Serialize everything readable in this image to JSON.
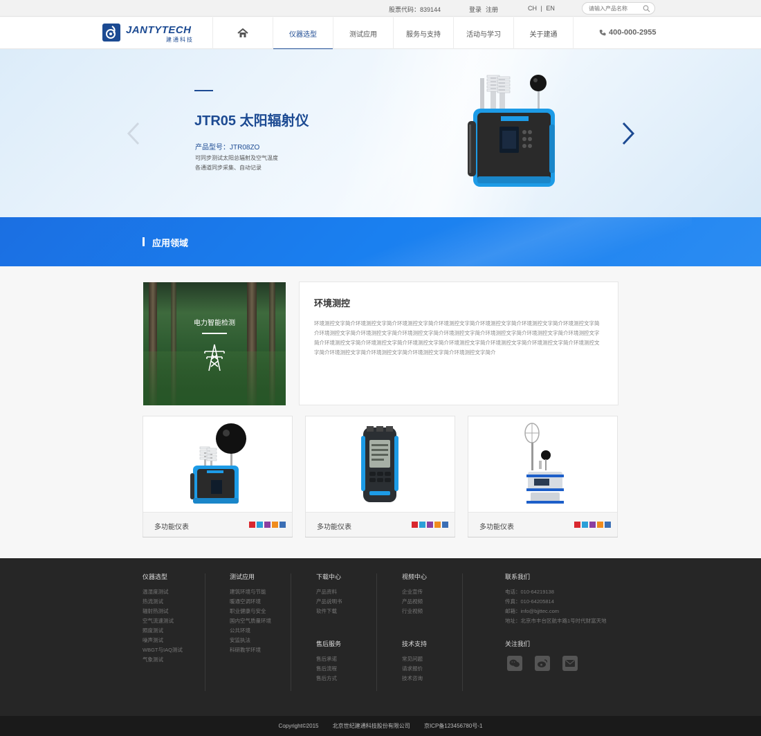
{
  "topbar": {
    "stock": "股票代码：839144",
    "login": "登录",
    "register": "注册",
    "lang_ch": "CH",
    "lang_sep": "|",
    "lang_en": "EN",
    "search_placeholder": "请输入产品名称"
  },
  "logo": {
    "name": "JANTYTECH",
    "sub": "建通科技"
  },
  "nav": {
    "items": [
      {
        "label": "仪器选型",
        "active": true
      },
      {
        "label": "测试应用"
      },
      {
        "label": "服务与支持"
      },
      {
        "label": "活动与学习"
      },
      {
        "label": "关于建通"
      }
    ],
    "phone": "400-000-2955"
  },
  "banner": {
    "title": "JTR05 太阳辐射仪",
    "model": "产品型号：JTR08ZO",
    "desc_line1": "可同步测试太阳总辐射及空气温度",
    "desc_line2": "各通道同步采集、自动记录"
  },
  "apps": {
    "heading": "应用领域",
    "feature_label": "电力智能检测",
    "feature_title": "环境测控",
    "feature_text": "环境测控文字简介环境测控文字简介环境测控文字简介环境测控文字简介环境测控文字简介环境测控文字简介环境测控文字简介环境测控文字简介环境测控文字简介环境测控文字简介环境测控文字简介环境测控文字简介环境测控文字简介环境测控文字简介环境测控文字简介环境测控文字简介环境测控文字简介环境测控文字简介环境测控文字简介环境测控文字简介环境测控文字简介环境测控文字简介环境测控文字简介环境测控文字简介环境测控文字简介"
  },
  "products": [
    {
      "name": "多功能仪表"
    },
    {
      "name": "多功能仪表"
    },
    {
      "name": "多功能仪表"
    }
  ],
  "product_icon_colors": [
    "#d9282f",
    "#2b9fd8",
    "#8b3fa0",
    "#f08c1e",
    "#3b6fb5"
  ],
  "footer": {
    "col1": {
      "title": "仪器选型",
      "items": [
        "温湿度测试",
        "热流测试",
        "辐射热测试",
        "空气流速测试",
        "照度测试",
        "噪声测试",
        "WBGT与IAQ测试",
        "气象测试"
      ]
    },
    "col2": {
      "title": "测试应用",
      "items": [
        "建筑环境与节能",
        "暖通空调环境",
        "职业健康与安全",
        "国内空气质量环境",
        "公共环境",
        "安监执法",
        "科研教学环境"
      ]
    },
    "col3": {
      "title": "下载中心",
      "items": [
        "产品资料",
        "产品说明书",
        "软件下载"
      ]
    },
    "col4": {
      "title": "视频中心",
      "items": [
        "企业宣传",
        "产品视频",
        "行业视频"
      ]
    },
    "col5": {
      "title": "售后服务",
      "items": [
        "售后承诺",
        "售后流程",
        "售后方式"
      ]
    },
    "col6": {
      "title": "技术支持",
      "items": [
        "常见问题",
        "请求报价",
        "技术咨询"
      ]
    },
    "contact": {
      "title": "联系我们",
      "items": [
        "电话：010-64219138",
        "传真：010-64205814",
        "邮箱：info@bjjttec.com",
        "地址：北京市丰台区航丰路1号时代财富天地"
      ]
    },
    "follow": {
      "title": "关注我们"
    }
  },
  "copyright": {
    "left": "Copyright©2015",
    "company": "北京世纪建通科技股份有限公司",
    "icp": "京ICP备123456780号-1"
  }
}
